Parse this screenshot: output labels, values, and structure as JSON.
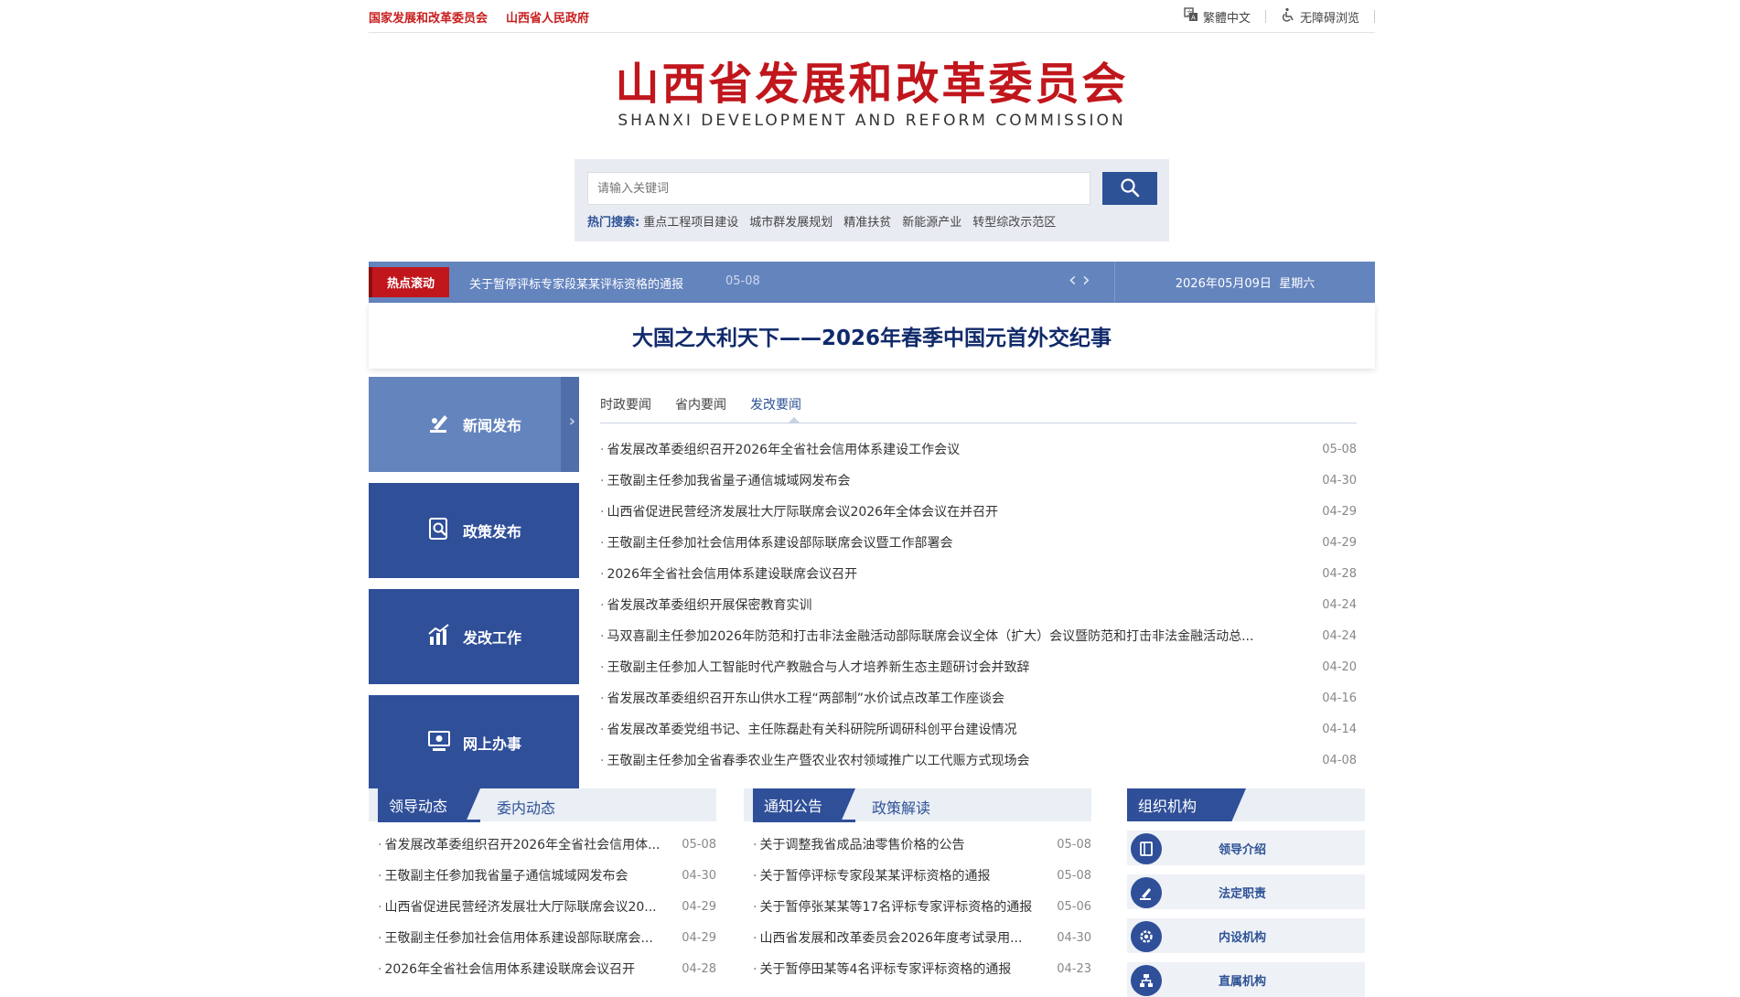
{
  "topbar": {
    "link1": "国家发展和改革委员会",
    "link2": "山西省人民政府",
    "traditional": "繁體中文",
    "accessible": "无障碍浏览"
  },
  "logo": {
    "cn": "山西省发展和改革委员会",
    "en": "SHANXI DEVELOPMENT AND REFORM COMMISSION"
  },
  "search": {
    "placeholder": "请输入关键词",
    "hot_label": "热门搜索:",
    "hot": [
      "重点工程项目建设",
      "城市群发展规划",
      "精准扶贫",
      "新能源产业",
      "转型综改示范区"
    ]
  },
  "ticker": {
    "label": "热点滚动",
    "text": "关于暂停评标专家段某某评标资格的通报",
    "date": "05-08",
    "today": "2026年05月09日",
    "weekday": "星期六"
  },
  "headline": "大国之大利天下——2026年春季中国元首外交纪事",
  "leftnav": [
    "新闻发布",
    "政策发布",
    "发改工作",
    "网上办事"
  ],
  "news": {
    "tabs": [
      "时政要闻",
      "省内要闻",
      "发改要闻"
    ],
    "items": [
      {
        "t": "省发展改革委组织召开2026年全省社会信用体系建设工作会议",
        "d": "05-08"
      },
      {
        "t": "王敬副主任参加我省量子通信城域网发布会",
        "d": "04-30"
      },
      {
        "t": "山西省促进民营经济发展壮大厅际联席会议2026年全体会议在并召开",
        "d": "04-29"
      },
      {
        "t": "王敬副主任参加社会信用体系建设部际联席会议暨工作部署会",
        "d": "04-29"
      },
      {
        "t": "2026年全省社会信用体系建设联席会议召开",
        "d": "04-28"
      },
      {
        "t": "省发展改革委组织开展保密教育实训",
        "d": "04-24"
      },
      {
        "t": "马双喜副主任参加2026年防范和打击非法金融活动部际联席会议全体（扩大）会议暨防范和打击非法金融活动总...",
        "d": "04-24"
      },
      {
        "t": "王敬副主任参加人工智能时代产教融合与人才培养新生态主题研讨会并致辞",
        "d": "04-20"
      },
      {
        "t": "省发展改革委组织召开东山供水工程“两部制”水价试点改革工作座谈会",
        "d": "04-16"
      },
      {
        "t": "省发展改革委党组书记、主任陈磊赴有关科研院所调研科创平台建设情况",
        "d": "04-14"
      },
      {
        "t": "王敬副主任参加全省春季农业生产暨农业农村领域推广以工代赈方式现场会",
        "d": "04-08"
      }
    ]
  },
  "col1": {
    "tab1": "领导动态",
    "tab2": "委内动态",
    "items": [
      {
        "t": "省发展改革委组织召开2026年全省社会信用体...",
        "d": "05-08"
      },
      {
        "t": "王敬副主任参加我省量子通信城域网发布会",
        "d": "04-30"
      },
      {
        "t": "山西省促进民营经济发展壮大厅际联席会议20...",
        "d": "04-29"
      },
      {
        "t": "王敬副主任参加社会信用体系建设部际联席会...",
        "d": "04-29"
      },
      {
        "t": "2026年全省社会信用体系建设联席会议召开",
        "d": "04-28"
      }
    ]
  },
  "col2": {
    "tab1": "通知公告",
    "tab2": "政策解读",
    "items": [
      {
        "t": "关于调整我省成品油零售价格的公告",
        "d": "05-08"
      },
      {
        "t": "关于暂停评标专家段某某评标资格的通报",
        "d": "05-08"
      },
      {
        "t": "关于暂停张某某等17名评标专家评标资格的通报",
        "d": "05-06"
      },
      {
        "t": "山西省发展和改革委员会2026年度考试录用...",
        "d": "04-30"
      },
      {
        "t": "关于暂停田某等4名评标专家评标资格的通报",
        "d": "04-23"
      }
    ]
  },
  "org": {
    "title": "组织机构",
    "items": [
      "领导介绍",
      "法定职责",
      "内设机构",
      "直属机构"
    ]
  }
}
